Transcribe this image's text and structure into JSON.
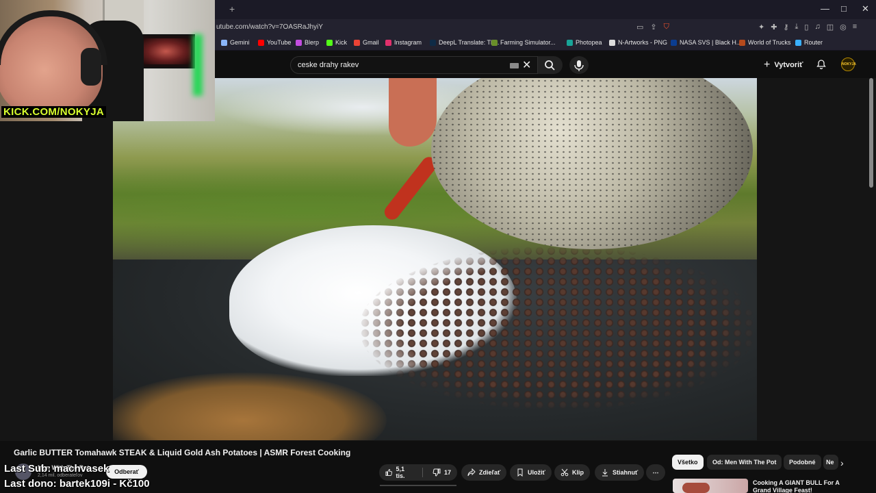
{
  "browser": {
    "new_tab": "+",
    "url": "utube.com/watch?v=7OASRaJhyiY",
    "window_controls": [
      "—",
      "□",
      "✕"
    ],
    "bookmarks": [
      {
        "label": "Gemini",
        "color": "#8ab4f8"
      },
      {
        "label": "YouTube",
        "color": "#ff0000"
      },
      {
        "label": "Blerp",
        "color": "#c34de0"
      },
      {
        "label": "Kick",
        "color": "#53fc18"
      },
      {
        "label": "Gmail",
        "color": "#ea4335"
      },
      {
        "label": "Instagram",
        "color": "#e1306c"
      },
      {
        "label": "DeepL Translate: Th...",
        "color": "#0f2b46"
      },
      {
        "label": "Farming Simulator...",
        "color": "#6a8f2a"
      },
      {
        "label": "Photopea",
        "color": "#18a497"
      },
      {
        "label": "N-Artworks - PNG",
        "color": "#dddddd"
      },
      {
        "label": "NASA SVS | Black H...",
        "color": "#0b3d91"
      },
      {
        "label": "World of Trucks",
        "color": "#b54a1c"
      },
      {
        "label": "Router",
        "color": "#3ab0ff"
      }
    ]
  },
  "youtube": {
    "search_value": "ceske drahy rakev",
    "create_label": "Vytvoriť",
    "avatar_label": "NOKYJA"
  },
  "webcam": {
    "label": "KICK.COM/NOKYJA"
  },
  "video": {
    "title": "Garlic BUTTER Tomahawk STEAK & Liquid Gold Ash Potatoes | ASMR Forest Cooking",
    "channel": "Men With The Pot",
    "subscribers": "2,14 mil. odberateľov",
    "subscribe_label": "Odberať",
    "likes": "5,1 tis.",
    "dislikes": "17",
    "share_label": "Zdieľať",
    "save_label": "Uložiť",
    "clip_label": "Klip",
    "download_label": "Stiahnuť",
    "more_label": "⋯"
  },
  "overlay": {
    "last_sub": "Last Sub: machvasek",
    "last_dono": "Last dono: bartek109i - Kč100"
  },
  "chips": [
    "Všetko",
    "Od: Men With The Pot",
    "Podobné",
    "Ne"
  ],
  "recommendation": {
    "title": "Cooking A GIANT BULL For A Grand Village Feast!"
  }
}
